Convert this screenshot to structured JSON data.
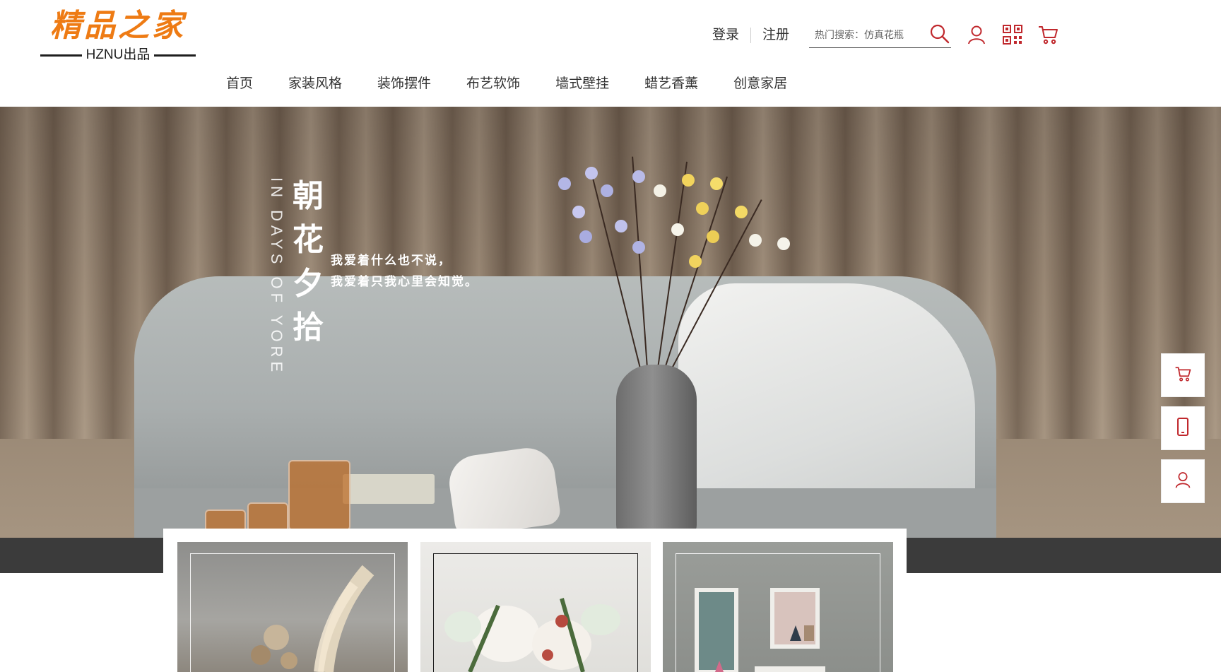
{
  "logo": {
    "title": "精品之家",
    "subtitle": "HZNU出品"
  },
  "header": {
    "login_label": "登录",
    "register_label": "注册",
    "search": {
      "placeholder": "热门搜索：仿真花瓶"
    }
  },
  "nav": {
    "items": [
      {
        "label": "首页"
      },
      {
        "label": "家装风格"
      },
      {
        "label": "装饰摆件"
      },
      {
        "label": "布艺软饰"
      },
      {
        "label": "墙式壁挂"
      },
      {
        "label": "蜡艺香薰"
      },
      {
        "label": "创意家居"
      }
    ]
  },
  "banner": {
    "title_chars": [
      "朝",
      "花",
      "夕",
      "拾"
    ],
    "title_en": "IN DAYS OF YORE",
    "line1": "我爱着什么也不说，",
    "line2": "我爱着只我心里会知觉。"
  },
  "icons": {
    "search": "search-icon",
    "user": "user-icon",
    "qr": "qr-code-icon",
    "cart": "cart-icon",
    "phone": "mobile-phone-icon"
  },
  "colors": {
    "brand_orange": "#ee7b14",
    "accent_red": "#c0282d",
    "text": "#333333"
  }
}
